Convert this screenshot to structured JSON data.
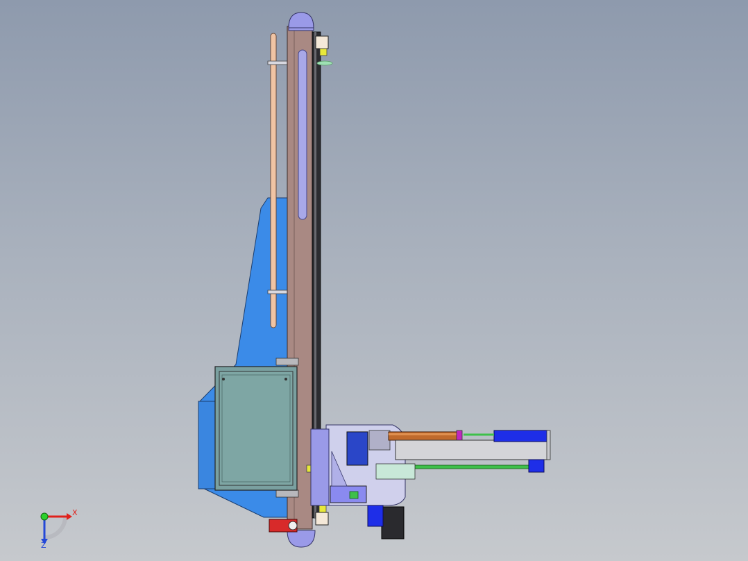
{
  "viewport": {
    "axis_triad": {
      "x_label": "X",
      "z_label": "Z",
      "x_color": "#e0211b",
      "y_color": "#2bd12b",
      "z_color": "#2448d8"
    }
  },
  "colors": {
    "background_top": "#8e9aad",
    "background_bottom": "#c6c9cd",
    "column": "#a98983",
    "base_blue": "#3b8be8",
    "cabinet": "#7aa0a0",
    "rod": "#f0c4a4",
    "actuator_blue": "#1e2ee8",
    "cylinder_copper": "#c06a2c",
    "end_cap_lavender": "#9a9ae8",
    "guide_green": "#3ec04a"
  }
}
